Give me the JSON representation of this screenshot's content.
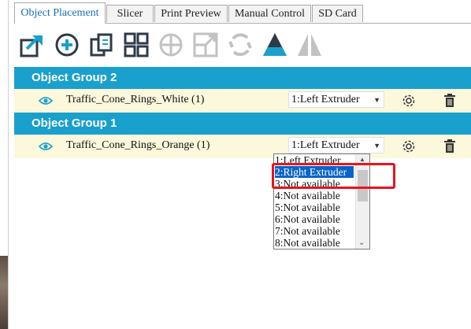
{
  "tabs": [
    {
      "label": "Object Placement",
      "active": true
    },
    {
      "label": "Slicer",
      "active": false
    },
    {
      "label": "Print Preview",
      "active": false
    },
    {
      "label": "Manual Control",
      "active": false
    },
    {
      "label": "SD Card",
      "active": false
    }
  ],
  "toolbar": {
    "icons": [
      "export-icon",
      "add-icon",
      "copy-icon",
      "grid-arrange-icon",
      "center-icon",
      "scale-icon",
      "rotate-icon",
      "flatten-icon",
      "mirror-icon"
    ]
  },
  "groups": [
    {
      "title": "Object Group 2",
      "object": {
        "name": "Traffic_Cone_Rings_White (1)",
        "extruder": "1:Left Extruder"
      }
    },
    {
      "title": "Object Group 1",
      "object": {
        "name": "Traffic_Cone_Rings_Orange (1)",
        "extruder": "1:Left Extruder"
      }
    }
  ],
  "dropdown": {
    "options": [
      "1:Left Extruder",
      "2:Right Extruder",
      "3:Not available",
      "4:Not available",
      "5:Not available",
      "6:Not available",
      "7:Not available",
      "8:Not available"
    ],
    "selected_index": 1
  },
  "colors": {
    "accent_tab": "#1a6fb5",
    "group_header": "#1aa0cc",
    "row_background": "#fbf8dc",
    "selection": "#0a64c8",
    "highlight": "#e8141c"
  }
}
